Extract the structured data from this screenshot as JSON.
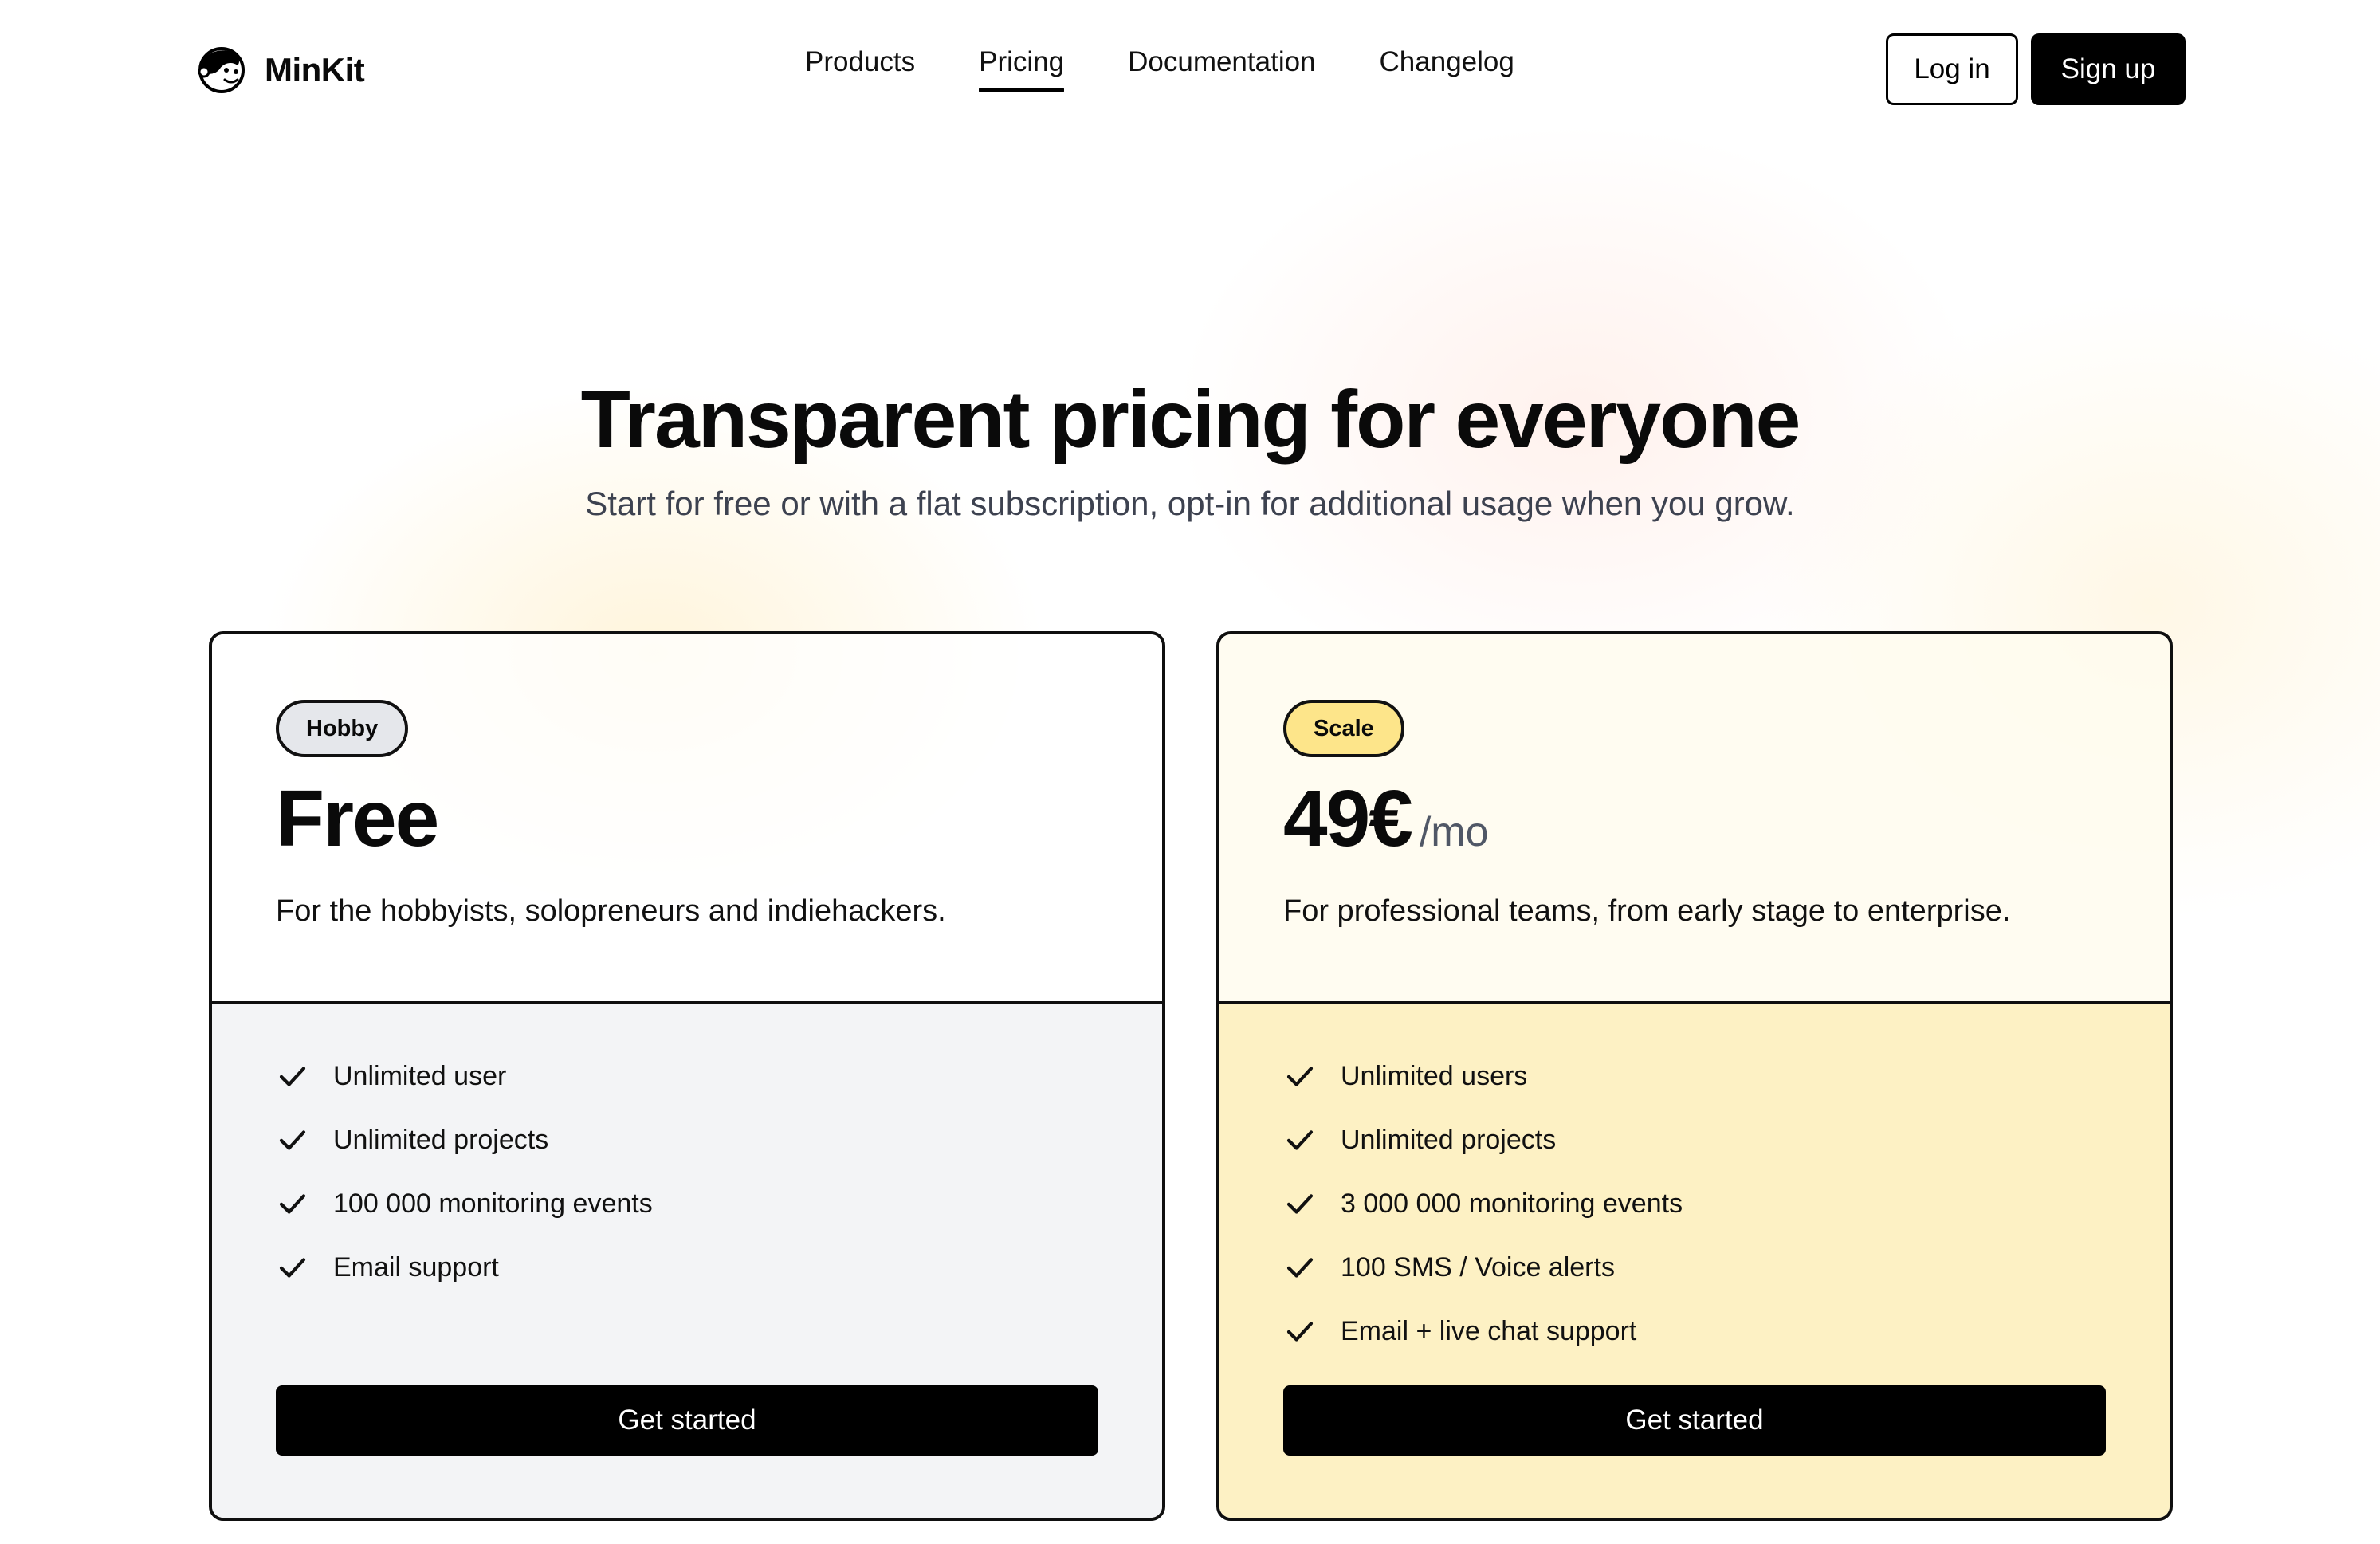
{
  "header": {
    "brand": "MinKit",
    "logo_icon": "monkey-face-icon",
    "nav": [
      {
        "label": "Products",
        "active": false
      },
      {
        "label": "Pricing",
        "active": true
      },
      {
        "label": "Documentation",
        "active": false
      },
      {
        "label": "Changelog",
        "active": false
      }
    ],
    "login_label": "Log in",
    "signup_label": "Sign up"
  },
  "hero": {
    "title": "Transparent pricing for everyone",
    "subtitle": "Start for free or with a flat subscription, opt-in for additional usage when you grow."
  },
  "plans": [
    {
      "badge": "Hobby",
      "price": "Free",
      "period": "",
      "description": "For the hobbyists, solopreneurs and indiehackers.",
      "features": [
        "Unlimited user",
        "Unlimited projects",
        "100 000 monitoring events",
        "Email support"
      ],
      "cta": "Get started"
    },
    {
      "badge": "Scale",
      "price": "49€",
      "period": "/mo",
      "description": "For professional teams, from early stage to enterprise.",
      "features": [
        "Unlimited users",
        "Unlimited projects",
        "3 000 000 monitoring events",
        "100 SMS / Voice alerts",
        "Email + live chat support"
      ],
      "cta": "Get started"
    }
  ],
  "colors": {
    "hobby_badge": "#e5e7eb",
    "scale_badge": "#fde58a",
    "hobby_features_bg": "#f3f4f6",
    "scale_features_bg": "#fdf1c4",
    "primary_button": "#000000"
  }
}
